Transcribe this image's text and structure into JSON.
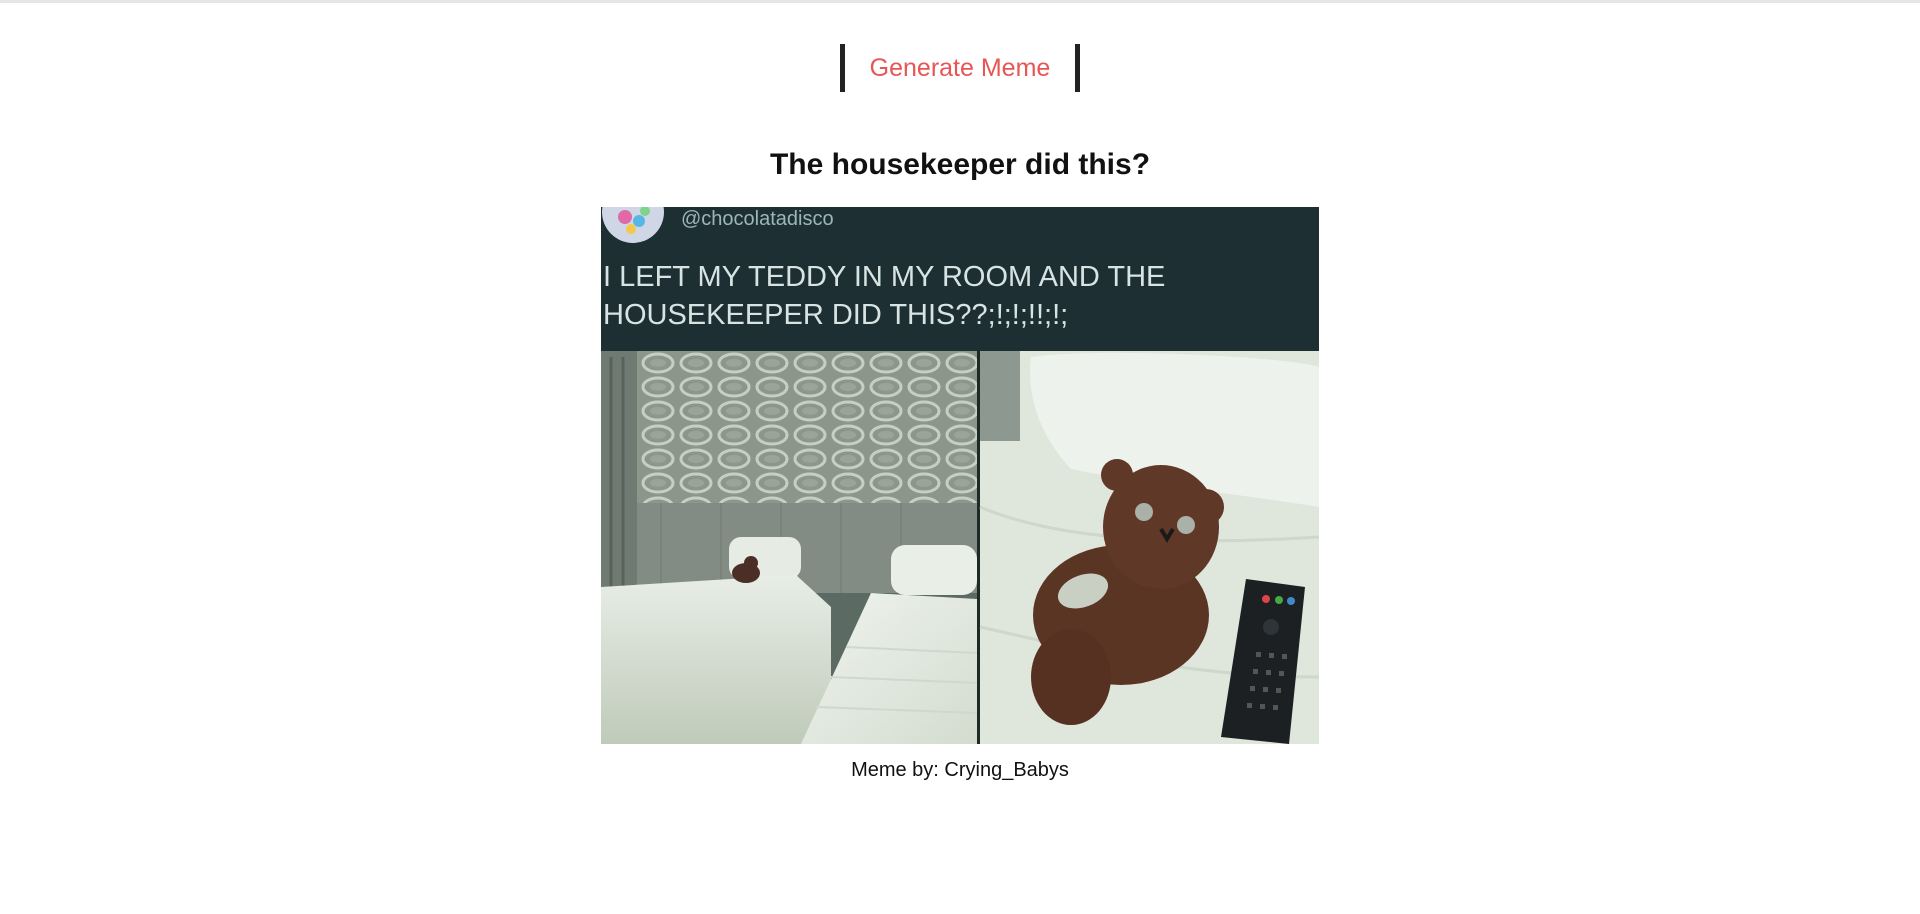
{
  "generate_button": {
    "label": "Generate Meme"
  },
  "meme": {
    "title": "The housekeeper did this?",
    "image": {
      "handle": "@chocolatadisco",
      "text_line1": "I LEFT MY TEDDY IN MY ROOM AND THE",
      "text_line2": "HOUSEKEEPER DID THIS??;!;!;!!;!;"
    },
    "caption": "Meme by: Crying_Babys"
  },
  "colors": {
    "button_text": "#e85555",
    "button_border": "#222222",
    "tweet_background": "#1d2f33"
  }
}
